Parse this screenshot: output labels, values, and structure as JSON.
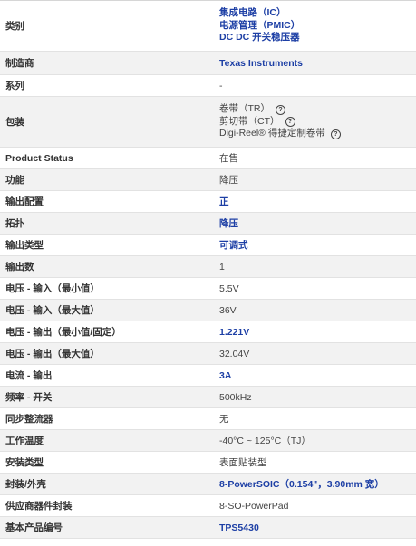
{
  "rows": [
    {
      "label": "类别",
      "values": [
        "集成电路（IC）",
        "电源管理（PMIC）",
        "DC DC 开关稳压器"
      ],
      "link": true
    },
    {
      "label": "制造商",
      "values": [
        "Texas Instruments"
      ],
      "link": true
    },
    {
      "label": "系列",
      "values": [
        "-"
      ],
      "link": false
    },
    {
      "label": "包装",
      "values": [
        "卷带（TR）",
        "剪切带（CT）",
        "Digi-Reel® 得捷定制卷带"
      ],
      "link": false,
      "help": true
    },
    {
      "label": "Product Status",
      "values": [
        "在售"
      ],
      "link": false
    },
    {
      "label": "功能",
      "values": [
        "降压"
      ],
      "link": false
    },
    {
      "label": "输出配置",
      "values": [
        "正"
      ],
      "link": true
    },
    {
      "label": "拓扑",
      "values": [
        "降压"
      ],
      "link": true
    },
    {
      "label": "输出类型",
      "values": [
        "可调式"
      ],
      "link": true
    },
    {
      "label": "输出数",
      "values": [
        "1"
      ],
      "link": false
    },
    {
      "label": "电压 - 输入（最小值）",
      "values": [
        "5.5V"
      ],
      "link": false
    },
    {
      "label": "电压 - 输入（最大值）",
      "values": [
        "36V"
      ],
      "link": false
    },
    {
      "label": "电压 - 输出（最小值/固定）",
      "values": [
        "1.221V"
      ],
      "link": true
    },
    {
      "label": "电压 - 输出（最大值）",
      "values": [
        "32.04V"
      ],
      "link": false
    },
    {
      "label": "电流 - 输出",
      "values": [
        "3A"
      ],
      "link": true
    },
    {
      "label": "频率 - 开关",
      "values": [
        "500kHz"
      ],
      "link": false
    },
    {
      "label": "同步整流器",
      "values": [
        "无"
      ],
      "link": false
    },
    {
      "label": "工作温度",
      "values": [
        "-40°C ~ 125°C（TJ）"
      ],
      "link": false
    },
    {
      "label": "安装类型",
      "values": [
        "表面贴装型"
      ],
      "link": false
    },
    {
      "label": "封装/外壳",
      "values": [
        "8-PowerSOIC（0.154\"，3.90mm 宽）"
      ],
      "link": true
    },
    {
      "label": "供应商器件封装",
      "values": [
        "8-SO-PowerPad"
      ],
      "link": false
    },
    {
      "label": "基本产品编号",
      "values": [
        "TPS5430"
      ],
      "link": true
    }
  ],
  "help_icon": {
    "name": "question-circle-icon",
    "glyph": "?"
  }
}
